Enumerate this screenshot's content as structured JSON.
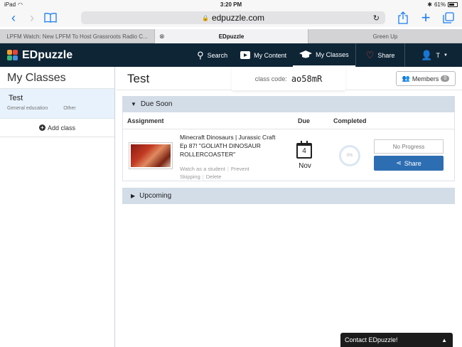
{
  "status_bar": {
    "device": "iPad",
    "time": "3:20 PM",
    "battery": "61%"
  },
  "browser": {
    "url": "edpuzzle.com",
    "tabs": [
      {
        "label": "LPFM Watch: New LPFM To Host Grassroots Radio C...",
        "active": false
      },
      {
        "label": "EDpuzzle",
        "active": true
      },
      {
        "label": "Green Up",
        "active": false
      }
    ]
  },
  "nav": {
    "brand": "EDpuzzle",
    "search": "Search",
    "my_content": "My Content",
    "my_classes": "My Classes",
    "share": "Share",
    "user": "T"
  },
  "sidebar": {
    "title": "My Classes",
    "classes": [
      {
        "name": "Test",
        "category": "General education",
        "subject": "Other"
      }
    ],
    "add_class": "Add class"
  },
  "main": {
    "class_title": "Test",
    "class_code_label": "class code:",
    "class_code": "ao58mR",
    "members_label": "Members",
    "members_count": "0",
    "due_soon_label": "Due Soon",
    "upcoming_label": "Upcoming",
    "columns": {
      "assignment": "Assignment",
      "due": "Due",
      "completed": "Completed"
    },
    "assignment": {
      "title": "Minecraft Dinosaurs | Jurassic Craft Ep 87! \"GOLIATH DINOSAUR ROLLERCOASTER\"",
      "watch": "Watch as a student",
      "prevent": "Prevent Skipping",
      "delete": "Delete",
      "due_day": "4",
      "due_month": "Nov",
      "completed_pct": "0%",
      "no_progress": "No Progress",
      "share": "Share"
    }
  },
  "contact": "Contact EDpuzzle!",
  "colors": {
    "nav_bg": "#0e2536",
    "section_bar": "#d3dde8",
    "share_btn": "#2d6eb3",
    "accent": "#1a7cf5"
  }
}
